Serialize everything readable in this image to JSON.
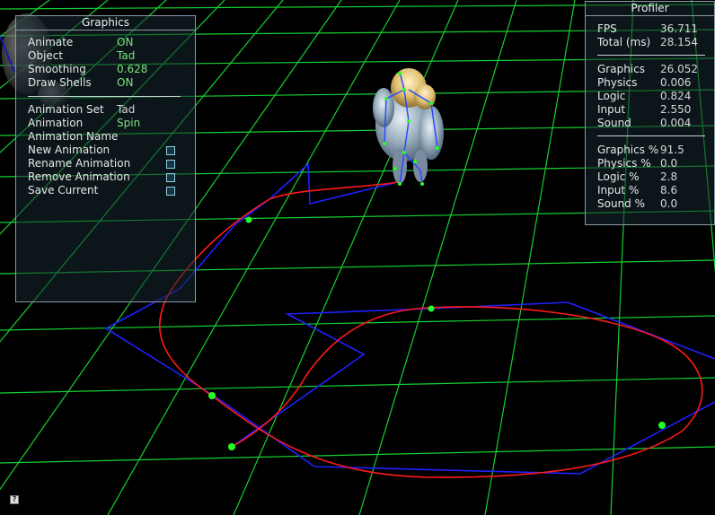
{
  "graphics": {
    "title": "Graphics",
    "settings": [
      {
        "label": "Animate",
        "value": "ON"
      },
      {
        "label": "Object",
        "value": "Tad"
      },
      {
        "label": "Smoothing",
        "value": "0.628"
      },
      {
        "label": "Draw Shells",
        "value": "ON"
      }
    ],
    "animation_set": {
      "label": "Animation Set",
      "value": "Tad"
    },
    "animation": {
      "label": "Animation",
      "value": "Spin"
    },
    "animation_name": {
      "label": "Animation Name"
    },
    "actions": [
      {
        "label": "New Animation"
      },
      {
        "label": "Rename Animation"
      },
      {
        "label": "Remove Animation"
      },
      {
        "label": "Save Current"
      }
    ]
  },
  "profiler": {
    "title": "Profiler",
    "timing": [
      {
        "label": "FPS",
        "value": "36.711"
      },
      {
        "label": "Total (ms)",
        "value": "28.154"
      }
    ],
    "subsystems": [
      {
        "label": "Graphics",
        "value": "26.052"
      },
      {
        "label": "Physics",
        "value": "0.006"
      },
      {
        "label": "Logic",
        "value": "0.824"
      },
      {
        "label": "Input",
        "value": "2.550"
      },
      {
        "label": "Sound",
        "value": "0.004"
      }
    ],
    "percentages": [
      {
        "label": "Graphics %",
        "value": "91.5"
      },
      {
        "label": "Physics %",
        "value": "0.0"
      },
      {
        "label": "Logic %",
        "value": "2.8"
      },
      {
        "label": "Input %",
        "value": "8.6"
      },
      {
        "label": "Sound %",
        "value": "0.0"
      }
    ]
  },
  "help": {
    "glyph": "?"
  },
  "colors": {
    "grid": "#1aff3a",
    "control_path": "#2020ff",
    "spline_path": "#ff1a1a",
    "node": "#22ff22",
    "value_on": "#7ee07e"
  }
}
